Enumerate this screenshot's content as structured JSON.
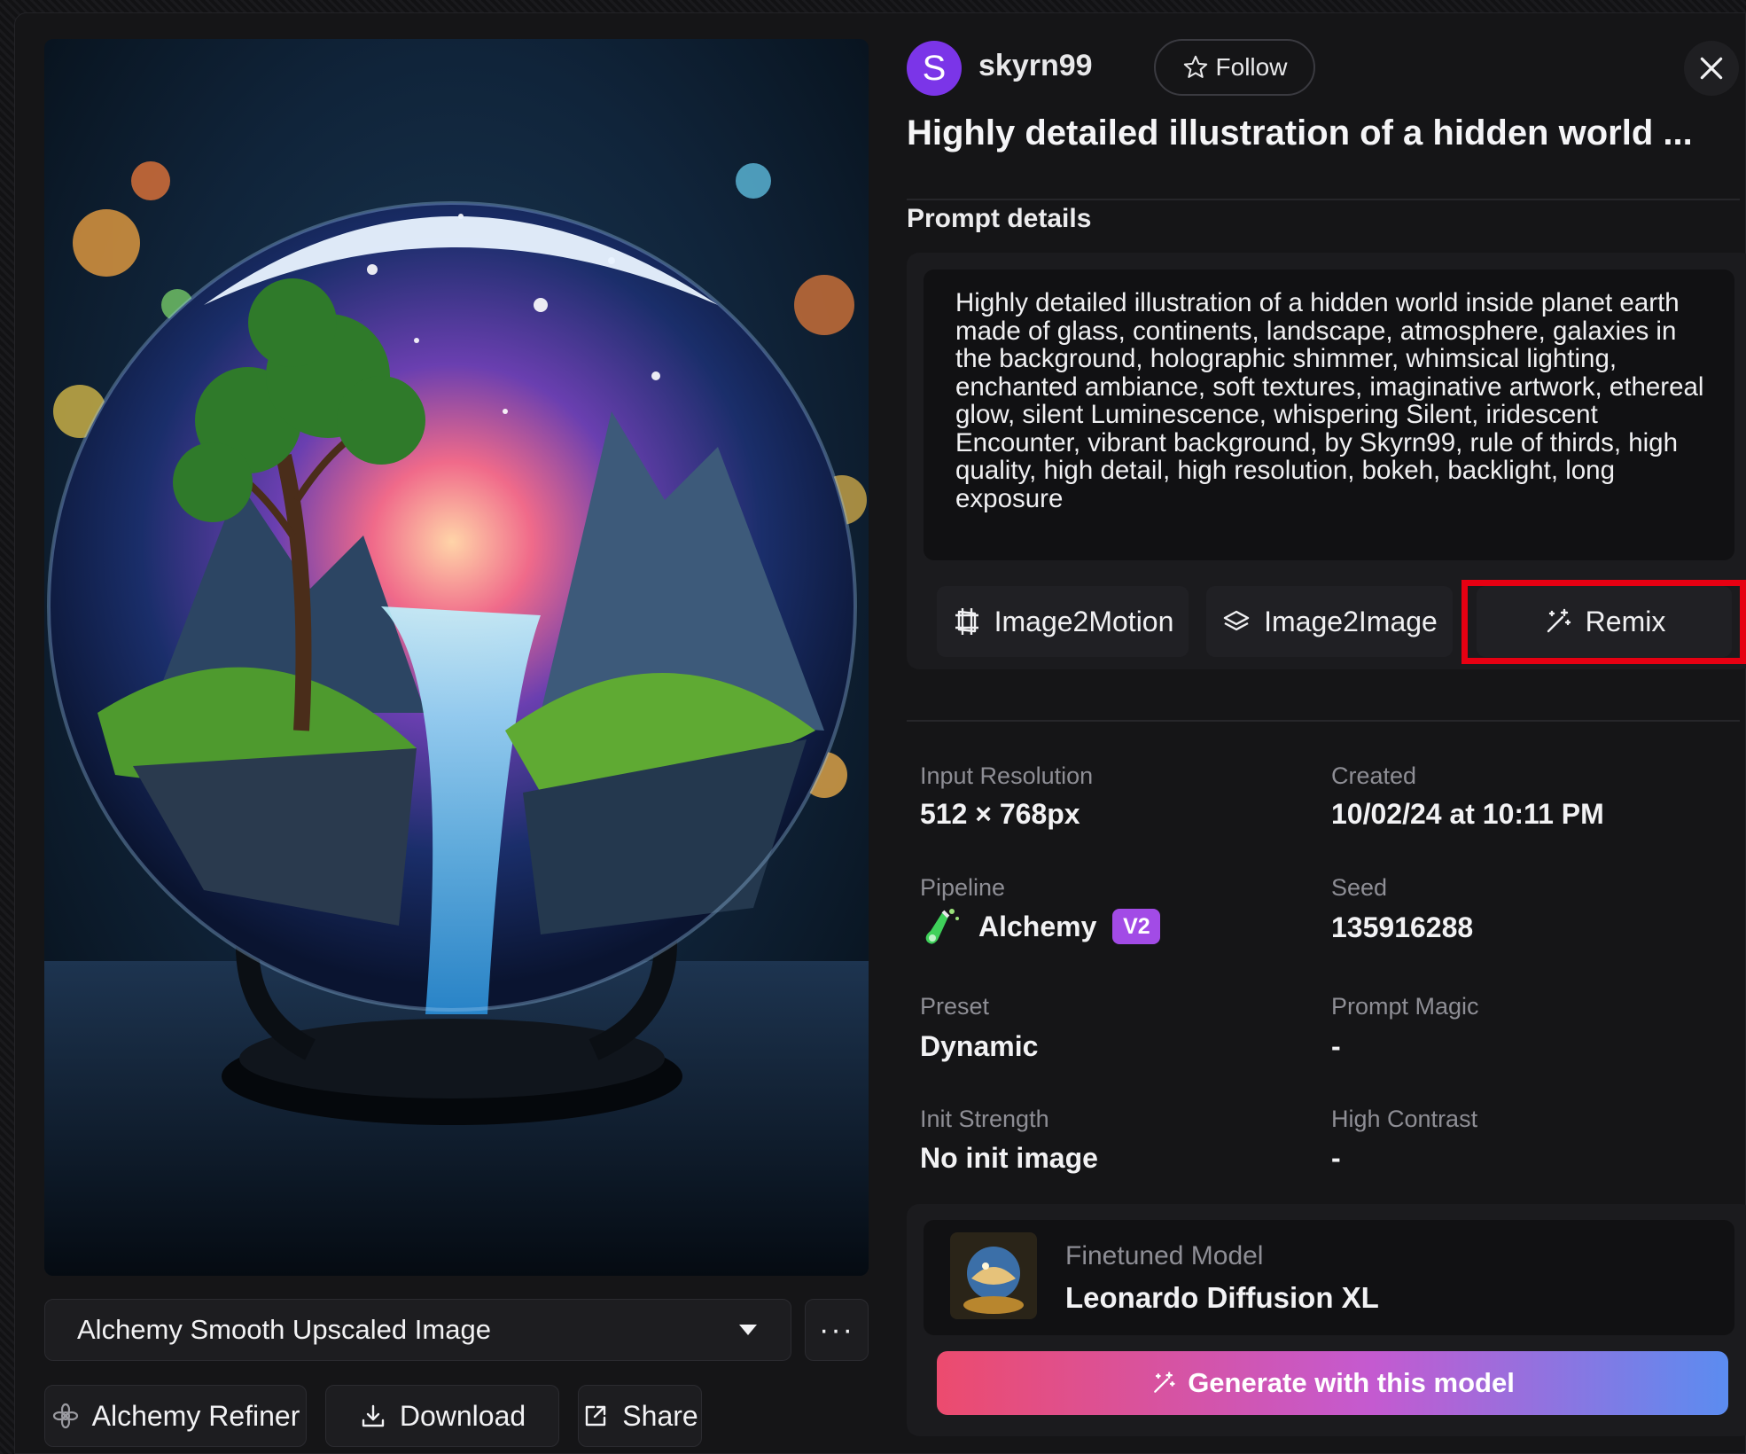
{
  "author": {
    "avatar_letter": "S",
    "username": "skyrn99",
    "avatar_color": "#7b35e8"
  },
  "header": {
    "follow_label": "Follow",
    "close_icon": "close-icon",
    "title": "Highly detailed illustration of a hidden world ..."
  },
  "prompt": {
    "section_label": "Prompt details",
    "text": "Highly detailed illustration of a hidden world inside planet earth made of glass, continents, landscape, atmosphere, galaxies in the background, holographic shimmer, whimsical lighting, enchanted ambiance, soft textures, imaginative artwork, ethereal glow, silent Luminescence, whispering Silent, iridescent Encounter, vibrant background, by Skyrn99, rule of thirds, high quality, high detail, high resolution, bokeh, backlight, long exposure"
  },
  "actions": {
    "image2motion": "Image2Motion",
    "image2image": "Image2Image",
    "remix": "Remix",
    "highlight_color": "#e60012"
  },
  "meta": {
    "input_resolution_label": "Input Resolution",
    "input_resolution_value": "512 × 768px",
    "created_label": "Created",
    "created_value": "10/02/24 at 10:11 PM",
    "pipeline_label": "Pipeline",
    "pipeline_value": "Alchemy",
    "pipeline_badge": "V2",
    "seed_label": "Seed",
    "seed_value": "135916288",
    "preset_label": "Preset",
    "preset_value": "Dynamic",
    "prompt_magic_label": "Prompt Magic",
    "prompt_magic_value": "-",
    "init_strength_label": "Init Strength",
    "init_strength_value": "No init image",
    "high_contrast_label": "High Contrast",
    "high_contrast_value": "-"
  },
  "model": {
    "label": "Finetuned Model",
    "name": "Leonardo Diffusion XL",
    "generate_label": "Generate with this model"
  },
  "image_controls": {
    "variant_selected": "Alchemy Smooth Upscaled Image",
    "more_label": "···",
    "refiner_label": "Alchemy Refiner",
    "download_label": "Download",
    "share_label": "Share"
  },
  "colors": {
    "background": "#151517",
    "accent_purple": "#a24be6",
    "generate_gradient": [
      "#ec4b6e",
      "#c45ad0",
      "#5b8cf0"
    ]
  }
}
